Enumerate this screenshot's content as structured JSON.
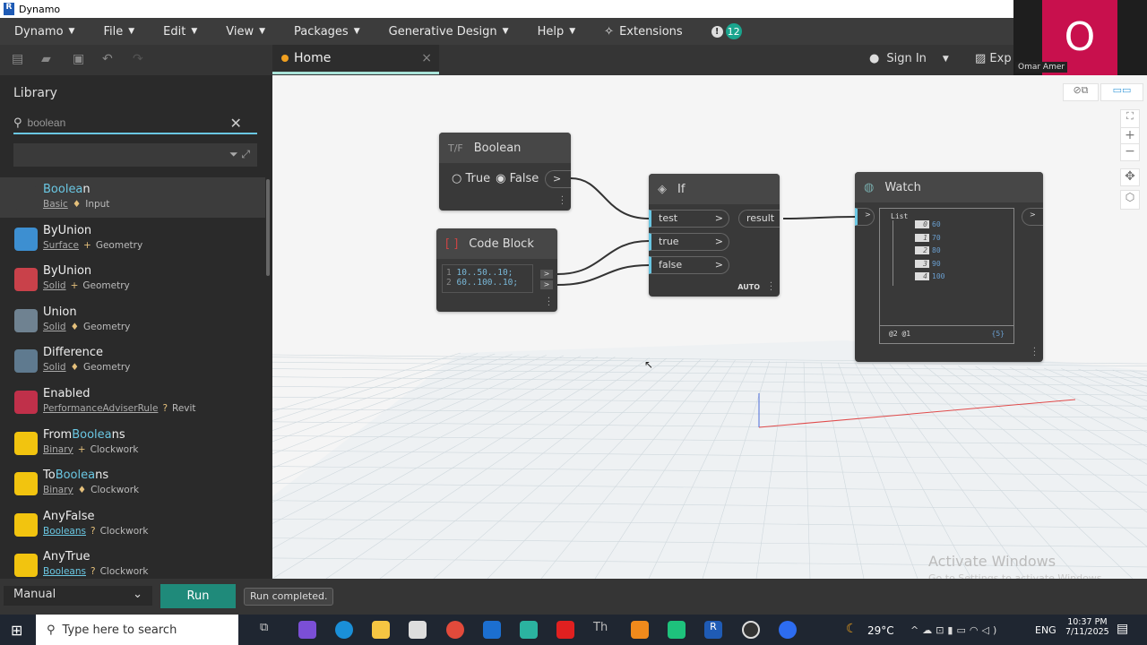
{
  "window": {
    "title": "Dynamo",
    "logo": "R"
  },
  "menu": [
    {
      "label": "Dynamo"
    },
    {
      "label": "File"
    },
    {
      "label": "Edit"
    },
    {
      "label": "View"
    },
    {
      "label": "Packages"
    },
    {
      "label": "Generative Design"
    },
    {
      "label": "Help"
    }
  ],
  "extensions": "Extensions",
  "notification_count": "12",
  "caret": "▼",
  "tab": {
    "label": "Home",
    "close": "×"
  },
  "header": {
    "sign_in": "Sign In",
    "export": "Exp"
  },
  "participant": {
    "initial": "O",
    "name": "Omar Amer"
  },
  "library": {
    "title": "Library",
    "search_value": "boolean",
    "items": [
      {
        "pre": "",
        "hl": "Boolea",
        "post": "n",
        "cat": "Basic",
        "sep": "♦",
        "group": "Input",
        "color": "#3c3c3c"
      },
      {
        "pre": "ByUnion",
        "hl": "",
        "post": "",
        "cat": "Surface",
        "sep": "+",
        "group": "Geometry",
        "color": "#3d8fd1"
      },
      {
        "pre": "ByUnion",
        "hl": "",
        "post": "",
        "cat": "Solid",
        "sep": "+",
        "group": "Geometry",
        "color": "#c9414a"
      },
      {
        "pre": "Union",
        "hl": "",
        "post": "",
        "cat": "Solid",
        "sep": "♦",
        "group": "Geometry",
        "color": "#6f8291"
      },
      {
        "pre": "Difference",
        "hl": "",
        "post": "",
        "cat": "Solid",
        "sep": "♦",
        "group": "Geometry",
        "color": "#5f7a8f"
      },
      {
        "pre": "Enabled",
        "hl": "",
        "post": "",
        "cat": "PerformanceAdviserRule",
        "sep": "?",
        "group": "Revit",
        "color": "#c0304a"
      },
      {
        "pre": "From",
        "hl": "Boolea",
        "post": "ns",
        "cat": "Binary",
        "sep": "+",
        "group": "Clockwork",
        "color": "#f2c40f"
      },
      {
        "pre": "To",
        "hl": "Boolea",
        "post": "ns",
        "cat": "Binary",
        "sep": "♦",
        "group": "Clockwork",
        "color": "#f2c40f"
      },
      {
        "pre": "AnyFalse",
        "hl": "",
        "post": "",
        "cat": "Booleans",
        "sep": "?",
        "group": "Clockwork",
        "color": "#f2c40f",
        "cat_hl": true
      },
      {
        "pre": "AnyTrue",
        "hl": "",
        "post": "",
        "cat": "Booleans",
        "sep": "?",
        "group": "Clockwork",
        "color": "#f2c40f",
        "cat_hl": true
      }
    ]
  },
  "nodes": {
    "boolean": {
      "title": "Boolean",
      "opt_true": "True",
      "opt_false": "False",
      "selected": "False",
      "out": ">"
    },
    "code": {
      "title": "Code Block",
      "lines": [
        {
          "n": "1",
          "code": "10..50..10;"
        },
        {
          "n": "2",
          "code": "60..100..10;"
        }
      ],
      "out": ">"
    },
    "if": {
      "title": "If",
      "inputs": [
        "test",
        "true",
        "false"
      ],
      "output": "result",
      "lacing": "AUTO",
      "arrow": ">"
    },
    "watch": {
      "title": "Watch",
      "list_label": "List",
      "items": [
        {
          "i": "0",
          "v": "60"
        },
        {
          "i": "1",
          "v": "70"
        },
        {
          "i": "2",
          "v": "80"
        },
        {
          "i": "3",
          "v": "90"
        },
        {
          "i": "4",
          "v": "100"
        }
      ],
      "levels": "@2 @1",
      "count": "{5}",
      "in": ">",
      "out": ">"
    }
  },
  "watermark": {
    "line1": "Activate Windows",
    "line2": "Go to Settings to activate Windows."
  },
  "bottom": {
    "run_mode": "Manual",
    "run": "Run",
    "status": "Run completed."
  },
  "taskbar": {
    "search": "Type here to search",
    "weather": "29°C",
    "lang": "ENG",
    "time": "10:37 PM",
    "date": "7/11/2025"
  }
}
